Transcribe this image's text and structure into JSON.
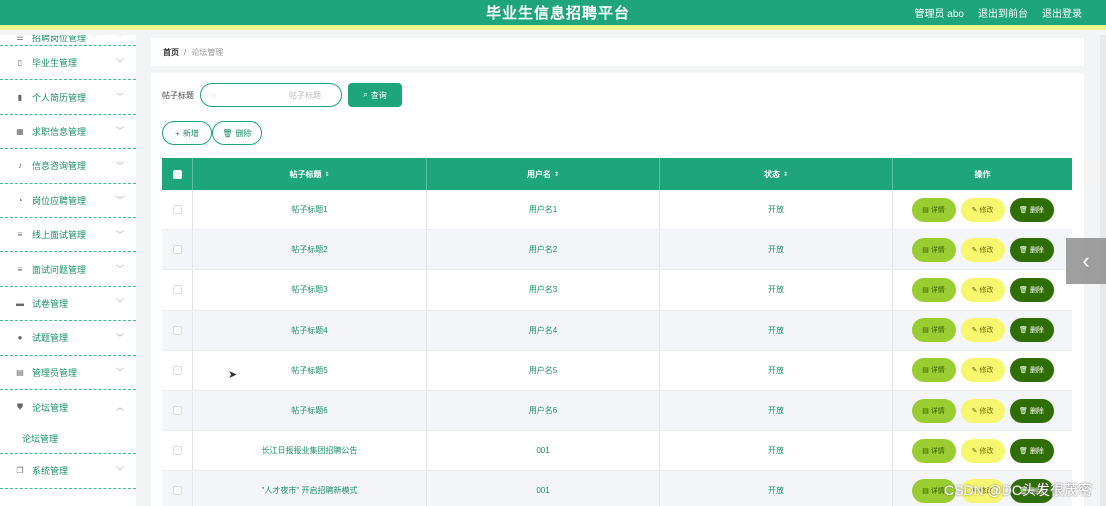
{
  "header": {
    "title": "毕业生信息招聘平台",
    "links": [
      "管理员 abo",
      "退出到前台",
      "退出登录"
    ]
  },
  "sidebar": {
    "items": [
      {
        "label": "招聘岗位管理",
        "icon": "list-icon"
      },
      {
        "label": "毕业生管理",
        "icon": "phone-icon"
      },
      {
        "label": "个人简历管理",
        "icon": "bar-chart-icon"
      },
      {
        "label": "求职信息管理",
        "icon": "grid-icon"
      },
      {
        "label": "信息咨询管理",
        "icon": "mic-icon"
      },
      {
        "label": "岗位应聘管理",
        "icon": "gauge-icon"
      },
      {
        "label": "线上面试管理",
        "icon": "list-icon"
      },
      {
        "label": "面试问题管理",
        "icon": "list-icon"
      },
      {
        "label": "试卷管理",
        "icon": "monitor-icon"
      },
      {
        "label": "试题管理",
        "icon": "user-icon"
      },
      {
        "label": "管理员管理",
        "icon": "table-icon"
      },
      {
        "label": "论坛管理",
        "icon": "shield-icon",
        "expanded": true
      },
      {
        "label": "系统管理",
        "icon": "copy-icon"
      }
    ],
    "sub_item": "论坛管理"
  },
  "breadcrumb": {
    "home": "首页",
    "separator": "/",
    "current": "论坛管理"
  },
  "search": {
    "label": "帖子标题",
    "placeholder": "帖子标题",
    "button": "查询"
  },
  "actions": {
    "add": "新增",
    "delete": "删除"
  },
  "table": {
    "columns": [
      "帖子标题",
      "用户名",
      "状态",
      "操作"
    ],
    "rows": [
      {
        "title": "帖子标题1",
        "user": "用户名1",
        "status": "开放"
      },
      {
        "title": "帖子标题2",
        "user": "用户名2",
        "status": "开放"
      },
      {
        "title": "帖子标题3",
        "user": "用户名3",
        "status": "开放"
      },
      {
        "title": "帖子标题4",
        "user": "用户名4",
        "status": "开放"
      },
      {
        "title": "帖子标题5",
        "user": "用户名5",
        "status": "开放"
      },
      {
        "title": "帖子标题6",
        "user": "用户名6",
        "status": "开放"
      },
      {
        "title": "长江日报报业集团招聘公告",
        "user": "001",
        "status": "开放"
      },
      {
        "title": "\"人才夜市\" 开启招聘新模式",
        "user": "001",
        "status": "开放"
      }
    ],
    "op_labels": {
      "detail": "详情",
      "edit": "修改",
      "delete": "删除"
    }
  },
  "watermark": "CSDN @DC头发很茂密",
  "colors": {
    "primary": "#1ea57a",
    "accent_bar": "#f4f58a",
    "detail": "#9acd32",
    "edit": "#f6f76e",
    "delete": "#2f6e05"
  }
}
